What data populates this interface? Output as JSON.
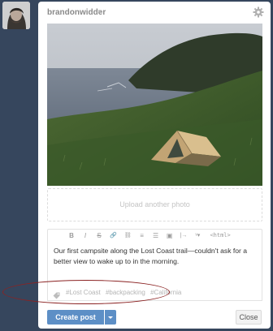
{
  "author": {
    "username": "brandonwidder",
    "dropdown_glyph": "▼",
    "avatar_icon": "avatar"
  },
  "header": {
    "settings_icon": "gear-icon"
  },
  "photo": {
    "subject": "tent-on-coastal-hillside"
  },
  "upload": {
    "label": "Upload another photo"
  },
  "toolbar": {
    "buttons": [
      {
        "name": "bold-button",
        "glyph": "B"
      },
      {
        "name": "italic-button",
        "glyph": "I"
      },
      {
        "name": "strikethrough-button",
        "glyph": "S"
      },
      {
        "name": "link-button",
        "glyph": "🔗"
      },
      {
        "name": "unlink-button",
        "glyph": "⛓"
      },
      {
        "name": "ordered-list-button",
        "glyph": "≡"
      },
      {
        "name": "bulleted-list-button",
        "glyph": "☰"
      },
      {
        "name": "image-button",
        "glyph": "▣"
      },
      {
        "name": "insert-button",
        "glyph": "|→"
      },
      {
        "name": "spellcheck-button",
        "glyph": "ᵛ▾"
      }
    ],
    "html_label": "<html>"
  },
  "post": {
    "body": "Our first campsite along the Lost Coast trail—couldn't ask for a better view to wake up to in the morning."
  },
  "tags": [
    "#Lost Coast",
    "#backpacking",
    "#California"
  ],
  "actions": {
    "create_label": "Create post",
    "close_label": "Close"
  },
  "colors": {
    "background": "#36465d",
    "primary_button": "#5d8fc6",
    "annotation": "#8b2323"
  }
}
